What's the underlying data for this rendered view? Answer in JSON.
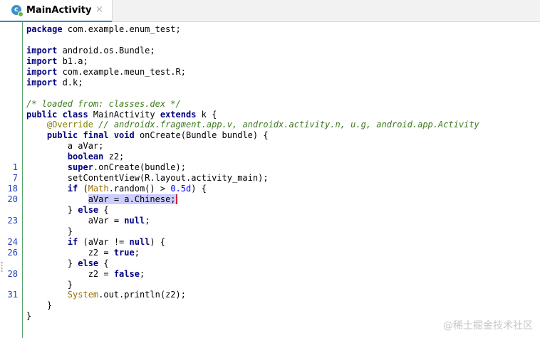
{
  "tab": {
    "title": "MainActivity",
    "icon": "class-c-icon",
    "close": "×"
  },
  "code": {
    "l1": {
      "kw": "package",
      "rest": " com.example.enum_test;"
    },
    "l3": {
      "kw": "import",
      "rest": " android.os.Bundle;"
    },
    "l4": {
      "kw": "import",
      "rest": " b1.a;"
    },
    "l5": {
      "kw": "import",
      "rest": " com.example.meun_test.R;"
    },
    "l6": {
      "kw": "import",
      "rest": " d.k;"
    },
    "l8": {
      "comment": "/* loaded from: classes.dex */"
    },
    "l9": {
      "kw": "public class",
      "mid": " MainActivity ",
      "kw2": "extends",
      "rest": " k {"
    },
    "l10": {
      "ann": "@Override",
      "comment": " // androidx.fragment.app.v, androidx.activity.n, u.g, android.app.Activity"
    },
    "l11": {
      "kw": "public final void",
      "rest": " onCreate(Bundle bundle) {"
    },
    "l12": {
      "text": "a aVar;"
    },
    "l13": {
      "kw": "boolean",
      "rest": " z2;"
    },
    "l14": {
      "num": "1",
      "kw": "super",
      "rest": ".onCreate(bundle);"
    },
    "l15": {
      "num": "7",
      "text": "setContentView(R.layout.activity_main);"
    },
    "l16": {
      "num": "18",
      "kw": "if",
      "a": " (",
      "cls": "Math",
      "b": ".random() > ",
      "val": "0.5d",
      "c": ") {"
    },
    "l17": {
      "num": "20",
      "text": "aVar = a.Chinese;"
    },
    "l18": {
      "a": "} ",
      "kw": "else",
      "b": " {"
    },
    "l19": {
      "num": "23",
      "a": "aVar = ",
      "kw": "null",
      "b": ";"
    },
    "l20": {
      "text": "}"
    },
    "l21": {
      "num": "24",
      "kw": "if",
      "a": " (aVar != ",
      "kw2": "null",
      "b": ") {"
    },
    "l22": {
      "num": "26",
      "a": "z2 = ",
      "kw": "true",
      "b": ";"
    },
    "l23": {
      "a": "} ",
      "kw": "else",
      "b": " {"
    },
    "l24": {
      "num": "28",
      "a": "z2 = ",
      "kw": "false",
      "b": ";"
    },
    "l25": {
      "text": "}"
    },
    "l26": {
      "num": "31",
      "cls": "System",
      "rest": ".out.println(z2);"
    },
    "l27": {
      "text": "}"
    },
    "l28": {
      "text": "}"
    }
  },
  "watermark": "@稀土掘金技术社区",
  "colors": {
    "keyword": "#000080",
    "comment": "#3d7a1f",
    "annotation": "#808000",
    "line_number": "#1e3dbd",
    "selection": "#ccccff",
    "caret": "#d1213a"
  }
}
